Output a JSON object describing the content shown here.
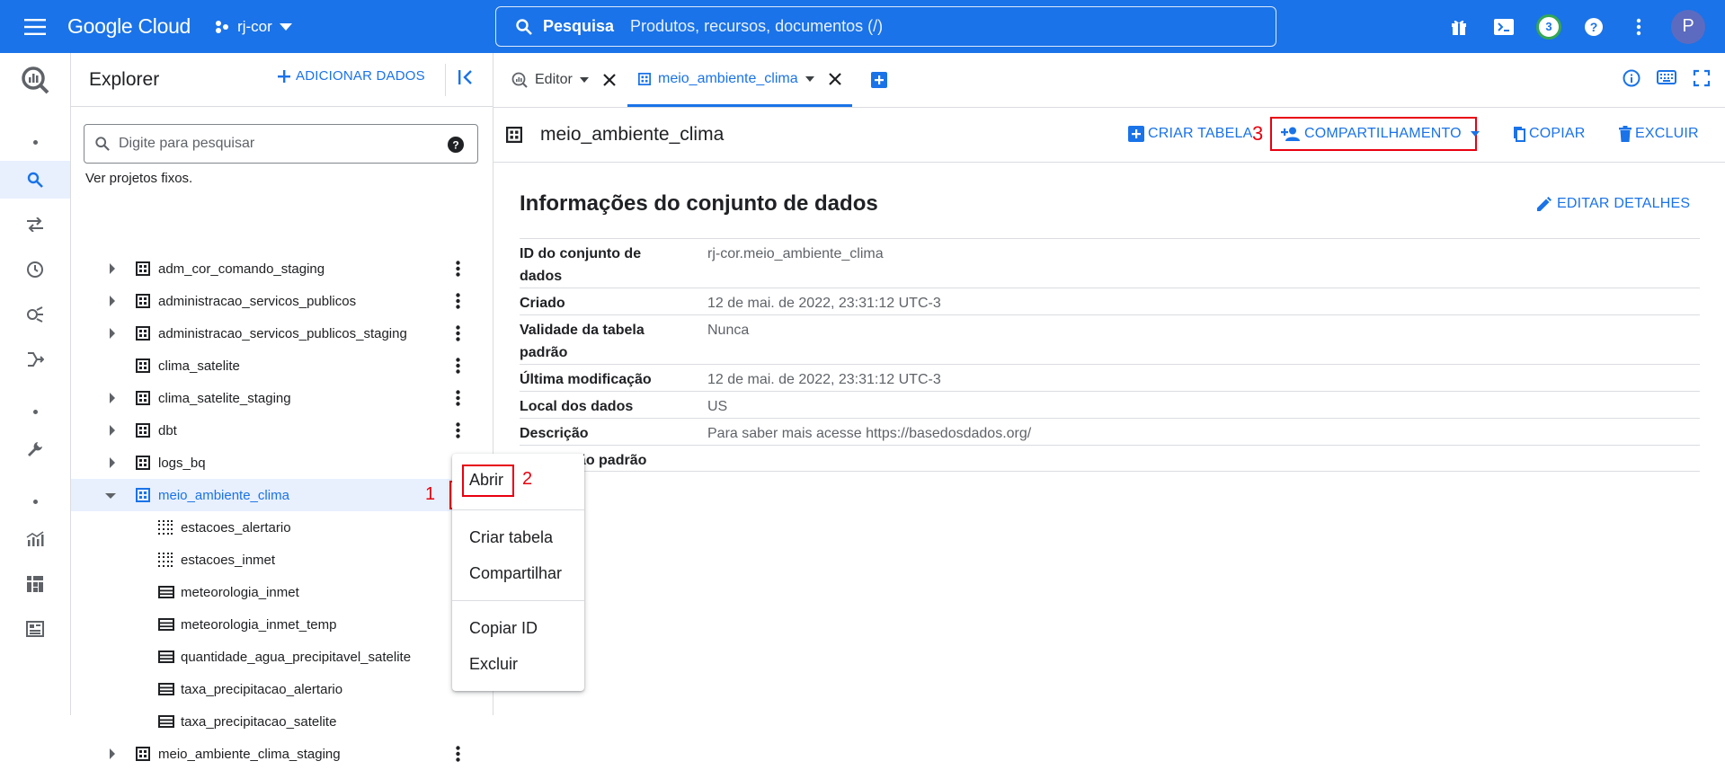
{
  "topbar": {
    "logo": "Google Cloud",
    "project": "rj-cor",
    "search_label": "Pesquisa",
    "search_placeholder": "Produtos, recursos, documentos (/)",
    "notifications_count": "3",
    "avatar_initial": "P"
  },
  "explorer": {
    "title": "Explorer",
    "add_data": "ADICIONAR DADOS",
    "search_placeholder": "Digite para pesquisar",
    "pinned_text": "Ver projetos fixos.",
    "items": [
      {
        "label": "adm_cor_comando_staging"
      },
      {
        "label": "administracao_servicos_publicos"
      },
      {
        "label": "administracao_servicos_publicos_staging"
      },
      {
        "label": "clima_satelite"
      },
      {
        "label": "clima_satelite_staging"
      },
      {
        "label": "dbt"
      },
      {
        "label": "logs_bq"
      },
      {
        "label": "meio_ambiente_clima"
      },
      {
        "label": "estacoes_alertario"
      },
      {
        "label": "estacoes_inmet"
      },
      {
        "label": "meteorologia_inmet"
      },
      {
        "label": "meteorologia_inmet_temp"
      },
      {
        "label": "quantidade_agua_precipitavel_satelite"
      },
      {
        "label": "taxa_precipitacao_alertario"
      },
      {
        "label": "taxa_precipitacao_satelite"
      },
      {
        "label": "meio_ambiente_clima_staging"
      }
    ],
    "annotation_1": "1"
  },
  "context_menu": {
    "items": [
      "Abrir",
      "Criar tabela",
      "Compartilhar",
      "Copiar ID",
      "Excluir"
    ],
    "annotation_2": "2"
  },
  "tabs": [
    {
      "label": "Editor"
    },
    {
      "label": "meio_ambiente_clima"
    }
  ],
  "dataset": {
    "name": "meio_ambiente_clima",
    "actions": {
      "create_table": "CRIAR TABELA",
      "share": "COMPARTILHAMENTO",
      "copy": "COPIAR",
      "delete": "EXCLUIR"
    },
    "annotation_3": "3",
    "info_title": "Informações do conjunto de dados",
    "edit_details": "EDITAR DETALHES",
    "details": [
      {
        "key": "ID do conjunto de dados",
        "value": "rj-cor.meio_ambiente_clima"
      },
      {
        "key": "Criado",
        "value": "12 de mai. de 2022, 23:31:12 UTC-3"
      },
      {
        "key": "Validade da tabela padrão",
        "value": "Nunca"
      },
      {
        "key": "Última modificação",
        "value": "12 de mai. de 2022, 23:31:12 UTC-3"
      },
      {
        "key": "Local dos dados",
        "value": "US"
      },
      {
        "key": "Descrição",
        "value": "Para saber mais acesse https://basedosdados.org/"
      },
      {
        "key": "Ordenação padrão",
        "value": ""
      }
    ]
  },
  "colors": {
    "brand_blue": "#1a73e8",
    "annotation_red": "#e8000f",
    "selection_bg": "#e8f0fe"
  }
}
